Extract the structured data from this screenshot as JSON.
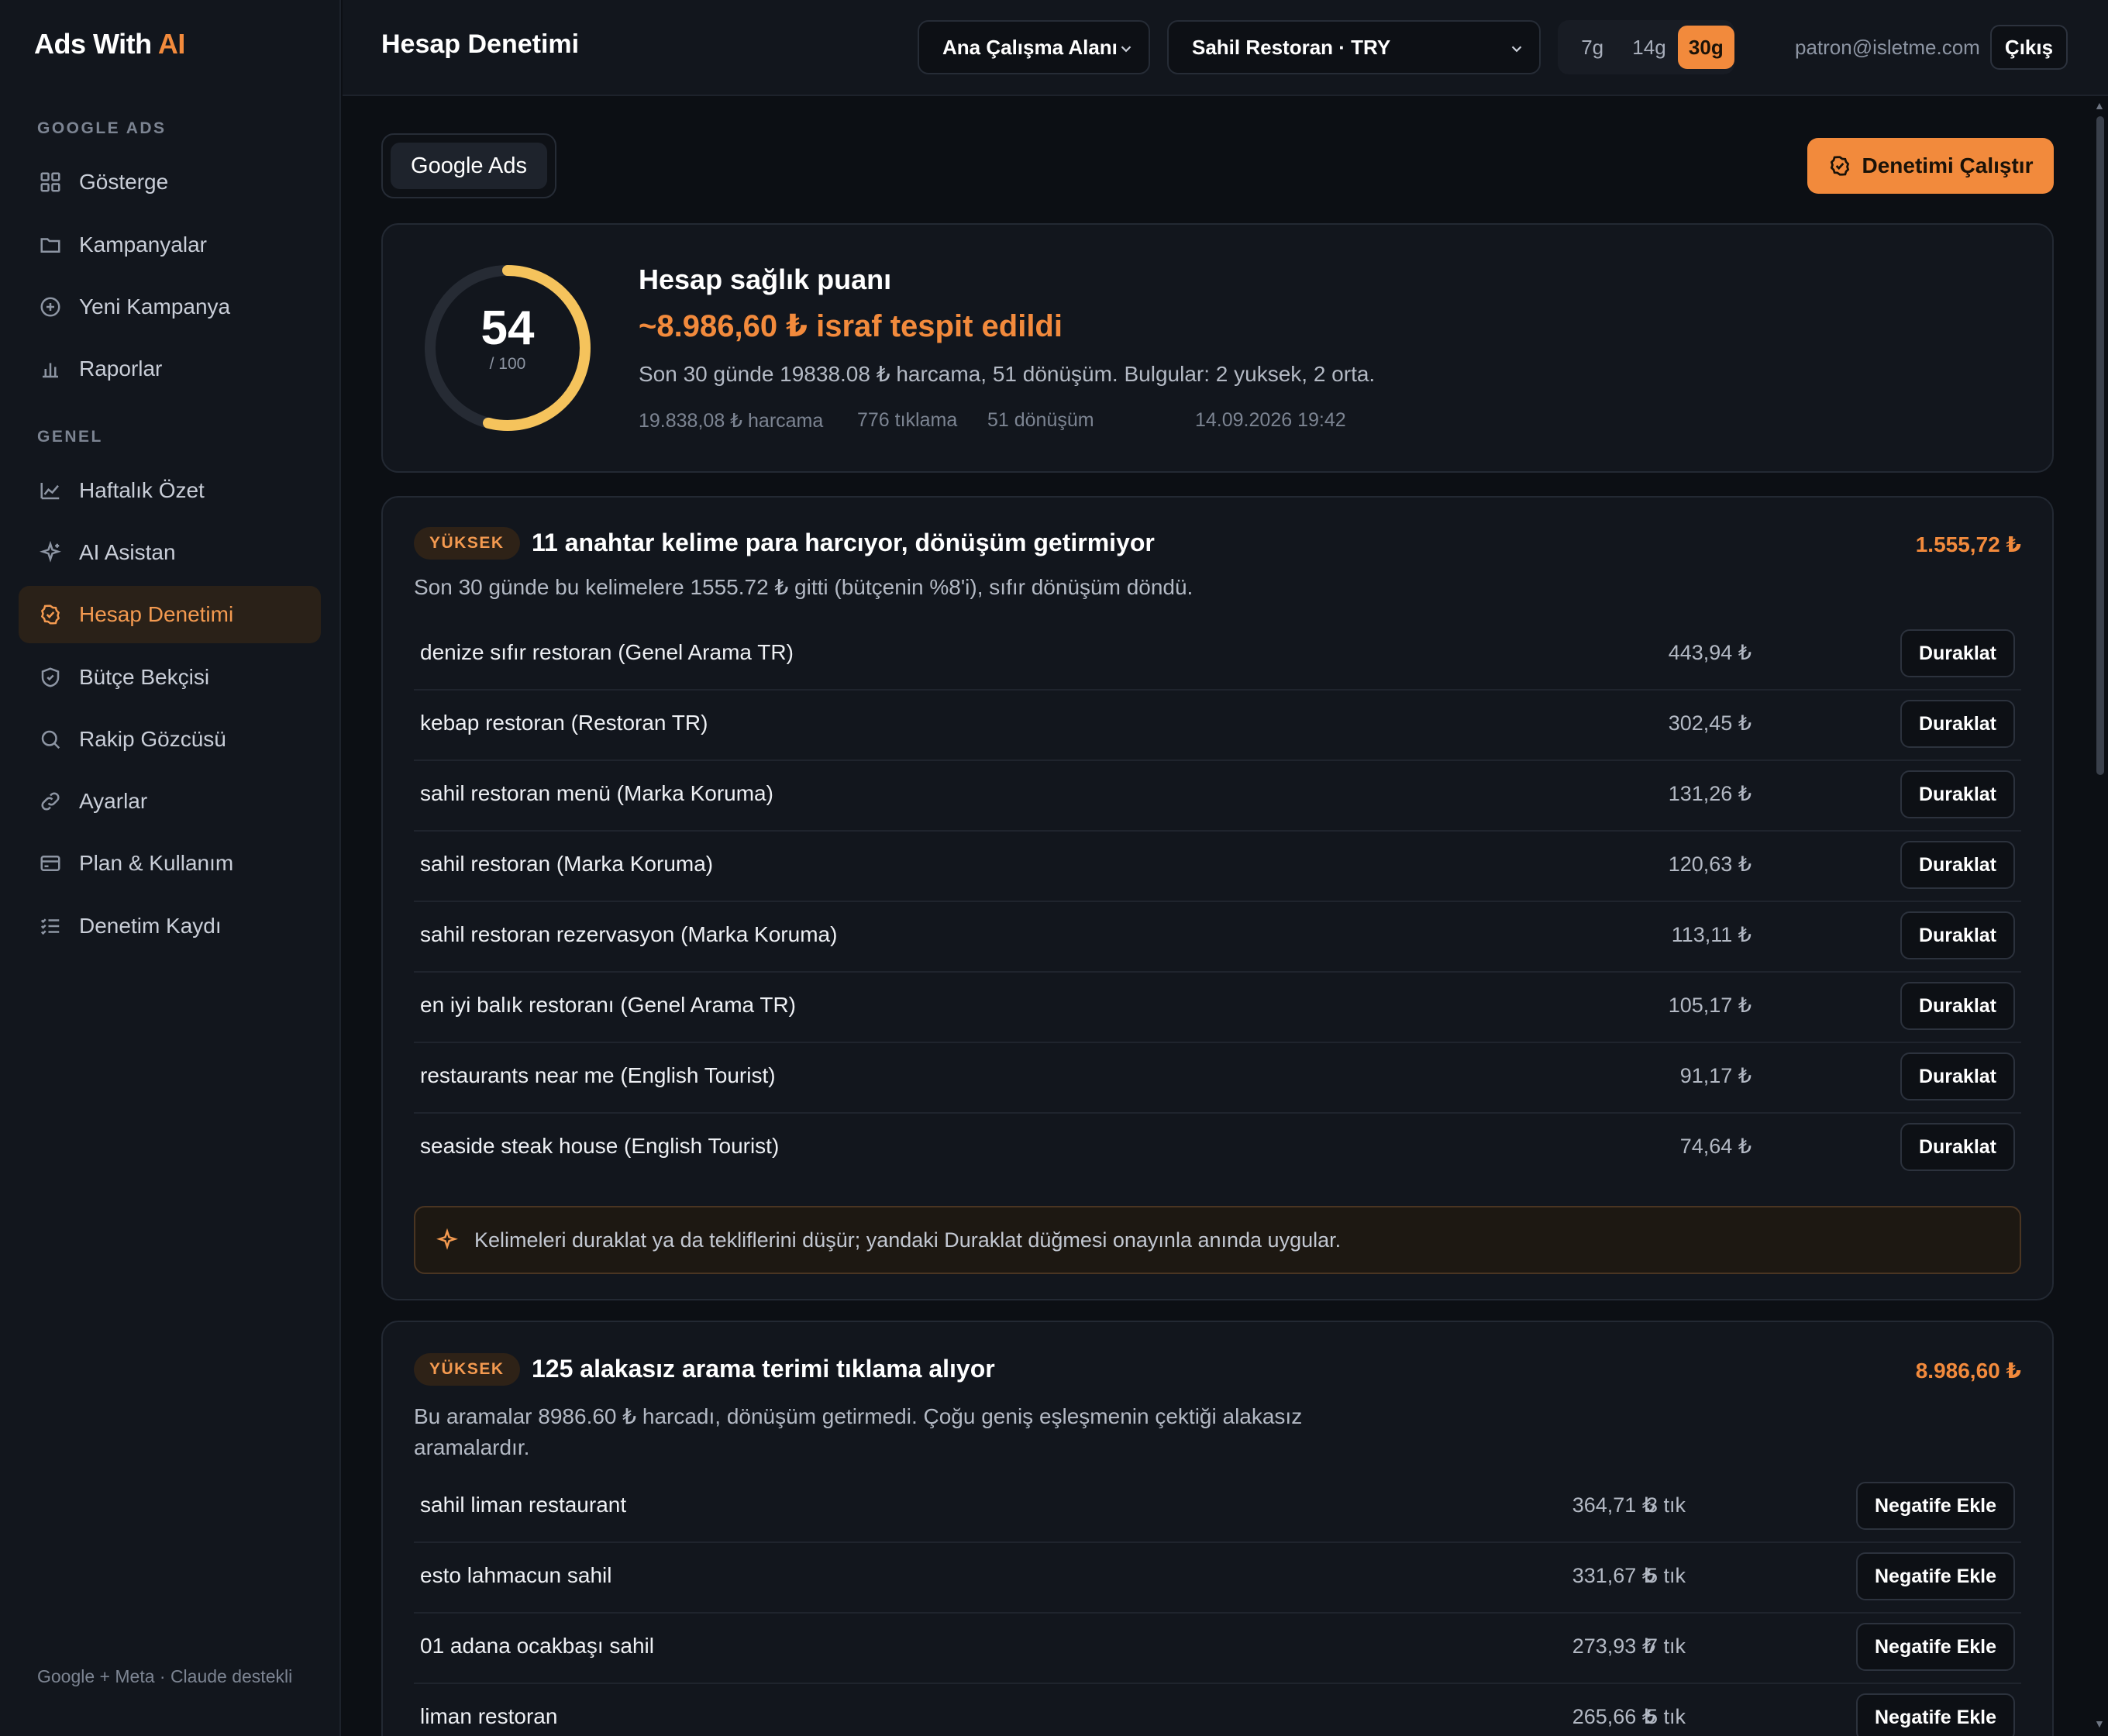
{
  "brand": {
    "name": "Ads With",
    "accent": "AI"
  },
  "sidebar": {
    "section_google": "GOOGLE ADS",
    "section_general": "GENEL",
    "items_google": [
      {
        "label": "Gösterge",
        "icon": "grid-icon"
      },
      {
        "label": "Kampanyalar",
        "icon": "folder-icon"
      },
      {
        "label": "Yeni Kampanya",
        "icon": "plus-circle-icon"
      },
      {
        "label": "Raporlar",
        "icon": "bar-chart-icon"
      }
    ],
    "items_general": [
      {
        "label": "Haftalık Özet",
        "icon": "line-chart-icon"
      },
      {
        "label": "AI Asistan",
        "icon": "sparkle-icon"
      },
      {
        "label": "Hesap Denetimi",
        "icon": "badge-check-icon",
        "active": true
      },
      {
        "label": "Bütçe Bekçisi",
        "icon": "shield-icon"
      },
      {
        "label": "Rakip Gözcüsü",
        "icon": "search-icon"
      },
      {
        "label": "Ayarlar",
        "icon": "link-icon"
      },
      {
        "label": "Plan & Kullanım",
        "icon": "credit-card-icon"
      },
      {
        "label": "Denetim Kaydı",
        "icon": "list-check-icon"
      }
    ],
    "footer": "Google + Meta · Claude destekli"
  },
  "topbar": {
    "title": "Hesap Denetimi",
    "workspace": "Ana Çalışma Alanı",
    "account": "Sahil Restoran · TRY",
    "ranges": [
      "7g",
      "14g",
      "30g"
    ],
    "active_range": "30g",
    "email": "patron@isletme.com",
    "logout": "Çıkış"
  },
  "main": {
    "tab": "Google Ads",
    "run_button": "Denetimi Çalıştır",
    "score": {
      "value": "54",
      "max": "/ 100",
      "fraction": 0.54,
      "title": "Hesap sağlık puanı",
      "waste": "~8.986,60 ₺ israf tespit edildi",
      "summary": "Son 30 günde 19838.08 ₺ harcama, 51 dönüşüm. Bulgular: 2 yuksek, 2 orta.",
      "spend": "19.838,08 ₺ harcama",
      "clicks": "776 tıklama",
      "conversions": "51 dönüşüm",
      "timestamp": "14.09.2026 19:42"
    },
    "finding1": {
      "badge": "YÜKSEK",
      "title": "11 anahtar kelime para harcıyor, dönüşüm getirmiyor",
      "amount": "1.555,72 ₺",
      "desc": "Son 30 günde bu kelimelere 1555.72 ₺ gitti (bütçenin %8'i), sıfır dönüşüm döndü.",
      "action_label": "Duraklat",
      "rows": [
        {
          "keyword": "denize sıfır restoran (Genel Arama TR)",
          "amount": "443,94 ₺"
        },
        {
          "keyword": "kebap restoran (Restoran TR)",
          "amount": "302,45 ₺"
        },
        {
          "keyword": "sahil restoran menü (Marka Koruma)",
          "amount": "131,26 ₺"
        },
        {
          "keyword": "sahil restoran (Marka Koruma)",
          "amount": "120,63 ₺"
        },
        {
          "keyword": "sahil restoran rezervasyon (Marka Koruma)",
          "amount": "113,11 ₺"
        },
        {
          "keyword": "en iyi balık restoranı (Genel Arama TR)",
          "amount": "105,17 ₺"
        },
        {
          "keyword": "restaurants near me (English Tourist)",
          "amount": "91,17 ₺"
        },
        {
          "keyword": "seaside steak house (English Tourist)",
          "amount": "74,64 ₺"
        }
      ],
      "hint": "Kelimeleri duraklat ya da tekliflerini düşür; yandaki Duraklat düğmesi onayınla anında uygular."
    },
    "finding2": {
      "badge": "YÜKSEK",
      "title": "125 alakasız arama terimi tıklama alıyor",
      "amount": "8.986,60 ₺",
      "desc_line1": "Bu aramalar 8986.60 ₺ harcadı, dönüşüm getirmedi. Çoğu geniş eşleşmenin çektiği alakasız",
      "desc_line2": "aramalardır.",
      "action_label": "Negatife Ekle",
      "rows": [
        {
          "term": "sahil liman restaurant",
          "clicks": "3 tık",
          "amount": "364,71 ₺"
        },
        {
          "term": "esto lahmacun sahil",
          "clicks": "5 tık",
          "amount": "331,67 ₺"
        },
        {
          "term": "01 adana ocakbaşı sahil",
          "clicks": "7 tık",
          "amount": "273,93 ₺"
        },
        {
          "term": "liman restoran",
          "clicks": "5 tık",
          "amount": "265,66 ₺"
        }
      ]
    }
  },
  "colors": {
    "accent": "#f28a3c",
    "ring": "#f5c35c",
    "bg": "#0c0f14",
    "panel": "#12161d"
  }
}
